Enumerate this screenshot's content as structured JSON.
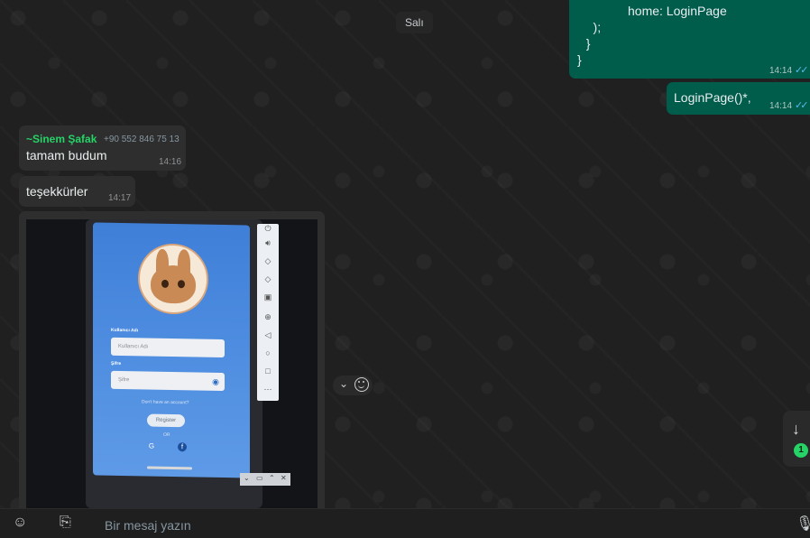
{
  "chat": {
    "date_label": "Salı",
    "outgoing": {
      "code_lines": [
        "home: LoginPage",
        "    );",
        "  }",
        "}"
      ],
      "code_time": "14:14",
      "login_text": "LoginPage()*,",
      "login_time": "14:14",
      "ticks": "✓✓"
    },
    "incoming": [
      {
        "sender": "~Sinem Şafak",
        "phone": "+90 552 846 75 13",
        "text": "tamam budum",
        "time": "14:16"
      },
      {
        "text": "teşekkürler",
        "time": "14:17"
      }
    ],
    "image_message": {
      "login_screen": {
        "username_label": "Kullanıcı Adı",
        "username_placeholder": "Kullanıcı Adı",
        "password_label": "Şifre",
        "password_placeholder": "Şifre",
        "no_account": "Don't have an account?",
        "register": "Register",
        "or": "OR",
        "google": "G",
        "facebook": "f"
      }
    }
  },
  "scroll": {
    "unread_count": "1"
  },
  "composer": {
    "placeholder": "Bir mesaj yazın"
  },
  "colors": {
    "outgoing_bubble": "#005c4b",
    "incoming_bubble": "#2e2e2e",
    "accent": "#25d366",
    "read_ticks": "#53bdeb"
  }
}
